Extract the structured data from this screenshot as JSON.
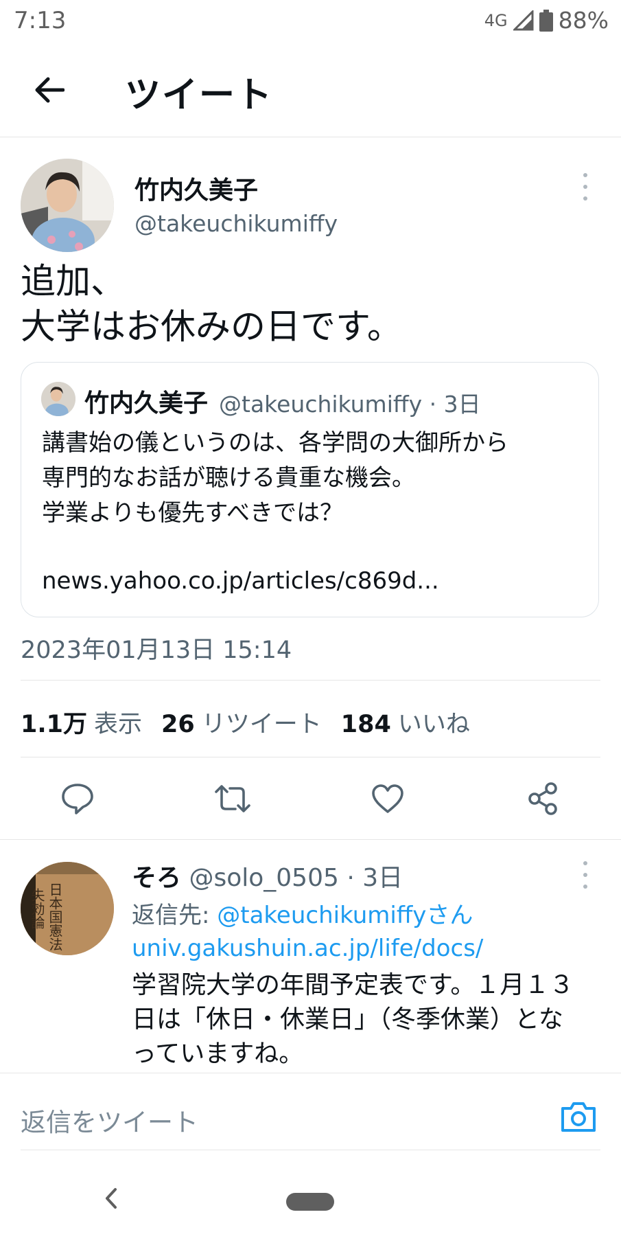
{
  "status_bar": {
    "time": "7:13",
    "network": "4G",
    "battery": "88%"
  },
  "header": {
    "title": "ツイート"
  },
  "tweet": {
    "author_name": "竹内久美子",
    "author_handle": "@takeuchikumiffy",
    "text": "追加、\n大学はお休みの日です。",
    "quote": {
      "author_name": "竹内久美子",
      "author_handle_time": "@takeuchikumiffy · 3日",
      "body": "講書始の儀というのは、各学問の大御所から\n専門的なお話が聴ける貴重な機会。\n学業よりも優先すべきでは？",
      "link": "news.yahoo.co.jp/articles/c869d..."
    },
    "timestamp": "2023年01月13日 15:14",
    "stats": {
      "views_count": "1.1万",
      "views_label": "表示",
      "retweets_count": "26",
      "retweets_label": "リツイート",
      "likes_count": "184",
      "likes_label": "いいね"
    }
  },
  "reply": {
    "author_name": "そろ",
    "author_meta": "@solo_0505 · 3日",
    "reply_to_prefix": "返信先: ",
    "reply_to_handle": "@takeuchikumiffyさん",
    "link": "univ.gakushuin.ac.jp/life/docs/",
    "body": "学習院大学の年間予定表です。１月１３\n日は「休日・休業日」（冬季休業）とな\nっていますね。",
    "avatar_text": "日本国憲法\n失効論"
  },
  "compose": {
    "placeholder": "返信をツイート"
  },
  "icons": {
    "back": "arrow-left-icon",
    "more": "more-vertical-icon",
    "reply": "comment-icon",
    "retweet": "retweet-icon",
    "like": "heart-icon",
    "share": "share-icon",
    "camera": "camera-icon"
  },
  "colors": {
    "accent": "#1d9bf0",
    "text": "#0f1419",
    "muted": "#536471"
  }
}
